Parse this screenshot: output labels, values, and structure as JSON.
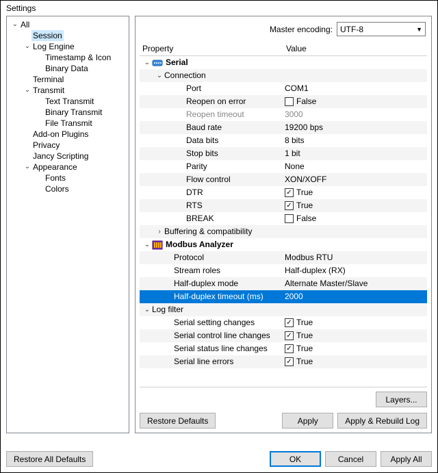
{
  "window": {
    "title": "Settings"
  },
  "tree": {
    "items": [
      {
        "depth": 0,
        "arrow": "open",
        "label": "All"
      },
      {
        "depth": 1,
        "arrow": "none",
        "label": "Session",
        "selected": true
      },
      {
        "depth": 1,
        "arrow": "open",
        "label": "Log Engine"
      },
      {
        "depth": 2,
        "arrow": "none",
        "label": "Timestamp & Icon"
      },
      {
        "depth": 2,
        "arrow": "none",
        "label": "Binary Data"
      },
      {
        "depth": 1,
        "arrow": "none",
        "label": "Terminal"
      },
      {
        "depth": 1,
        "arrow": "open",
        "label": "Transmit"
      },
      {
        "depth": 2,
        "arrow": "none",
        "label": "Text Transmit"
      },
      {
        "depth": 2,
        "arrow": "none",
        "label": "Binary Transmit"
      },
      {
        "depth": 2,
        "arrow": "none",
        "label": "File Transmit"
      },
      {
        "depth": 1,
        "arrow": "none",
        "label": "Add-on Plugins"
      },
      {
        "depth": 1,
        "arrow": "none",
        "label": "Privacy"
      },
      {
        "depth": 1,
        "arrow": "none",
        "label": "Jancy Scripting"
      },
      {
        "depth": 1,
        "arrow": "open",
        "label": "Appearance"
      },
      {
        "depth": 2,
        "arrow": "none",
        "label": "Fonts"
      },
      {
        "depth": 2,
        "arrow": "none",
        "label": "Colors"
      }
    ]
  },
  "encoding": {
    "label": "Master encoding:",
    "value": "UTF-8"
  },
  "grid": {
    "headers": {
      "property": "Property",
      "value": "Value"
    },
    "rows": [
      {
        "kind": "group",
        "depth": 0,
        "arrow": "open",
        "icon": "serial",
        "label": "Serial",
        "bold": true,
        "stripe": "odd"
      },
      {
        "kind": "group",
        "depth": 1,
        "arrow": "open",
        "label": "Connection",
        "stripe": "even"
      },
      {
        "kind": "prop",
        "depth": 2,
        "label": "Port",
        "value": "COM1",
        "stripe": "odd"
      },
      {
        "kind": "check",
        "depth": 2,
        "label": "Reopen on error",
        "checked": false,
        "text": "False",
        "stripe": "even"
      },
      {
        "kind": "prop",
        "depth": 2,
        "label": "Reopen timeout",
        "value": "3000",
        "disabled": true,
        "stripe": "odd"
      },
      {
        "kind": "prop",
        "depth": 2,
        "label": "Baud rate",
        "value": "19200 bps",
        "stripe": "even"
      },
      {
        "kind": "prop",
        "depth": 2,
        "label": "Data bits",
        "value": "8 bits",
        "stripe": "odd"
      },
      {
        "kind": "prop",
        "depth": 2,
        "label": "Stop bits",
        "value": "1 bit",
        "stripe": "even"
      },
      {
        "kind": "prop",
        "depth": 2,
        "label": "Parity",
        "value": "None",
        "stripe": "odd"
      },
      {
        "kind": "prop",
        "depth": 2,
        "label": "Flow control",
        "value": "XON/XOFF",
        "stripe": "even"
      },
      {
        "kind": "check",
        "depth": 2,
        "label": "DTR",
        "checked": true,
        "text": "True",
        "stripe": "odd"
      },
      {
        "kind": "check",
        "depth": 2,
        "label": "RTS",
        "checked": true,
        "text": "True",
        "stripe": "even"
      },
      {
        "kind": "check",
        "depth": 2,
        "label": "BREAK",
        "checked": false,
        "text": "False",
        "stripe": "odd"
      },
      {
        "kind": "group",
        "depth": 1,
        "arrow": "closed",
        "label": "Buffering & compatibility",
        "stripe": "even"
      },
      {
        "kind": "group",
        "depth": 0,
        "arrow": "open",
        "icon": "modbus",
        "label": "Modbus Analyzer",
        "bold": true,
        "stripe": "odd"
      },
      {
        "kind": "prop",
        "depth": 1,
        "label": "Protocol",
        "value": "Modbus RTU",
        "stripe": "even"
      },
      {
        "kind": "prop",
        "depth": 1,
        "label": "Stream roles",
        "value": "Half-duplex (RX)",
        "stripe": "odd"
      },
      {
        "kind": "prop",
        "depth": 1,
        "label": "Half-duplex mode",
        "value": "Alternate Master/Slave",
        "stripe": "even"
      },
      {
        "kind": "prop",
        "depth": 1,
        "label": "Half-duplex timeout (ms)",
        "value": "2000",
        "selected": true,
        "stripe": "sel"
      },
      {
        "kind": "group",
        "depth": 0,
        "arrow": "open",
        "label": "Log filter",
        "stripe": "even"
      },
      {
        "kind": "check",
        "depth": 1,
        "label": "Serial setting changes",
        "checked": true,
        "text": "True",
        "stripe": "odd"
      },
      {
        "kind": "check",
        "depth": 1,
        "label": "Serial control line changes",
        "checked": true,
        "text": "True",
        "stripe": "even"
      },
      {
        "kind": "check",
        "depth": 1,
        "label": "Serial status line changes",
        "checked": true,
        "text": "True",
        "stripe": "odd"
      },
      {
        "kind": "check",
        "depth": 1,
        "label": "Serial line errors",
        "checked": true,
        "text": "True",
        "stripe": "even"
      }
    ]
  },
  "buttons": {
    "layers": "Layers...",
    "restore_defaults": "Restore Defaults",
    "apply": "Apply",
    "apply_rebuild": "Apply & Rebuild Log",
    "restore_all": "Restore All Defaults",
    "ok": "OK",
    "cancel": "Cancel",
    "apply_all": "Apply All"
  }
}
